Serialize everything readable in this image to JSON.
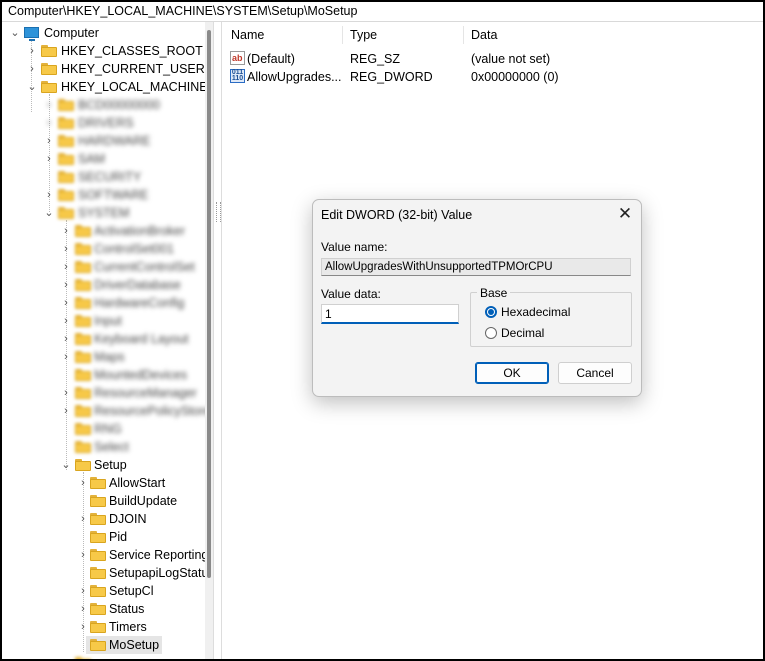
{
  "address_bar": {
    "path": "Computer\\HKEY_LOCAL_MACHINE\\SYSTEM\\Setup\\MoSetup"
  },
  "tree": {
    "root": "Computer",
    "hives": [
      {
        "label": "HKEY_CLASSES_ROOT",
        "chev": "›"
      },
      {
        "label": "HKEY_CURRENT_USER",
        "chev": "›"
      },
      {
        "label": "HKEY_LOCAL_MACHINE",
        "chev": "⌄"
      }
    ],
    "blurred_keys": [
      "BCD00000000",
      "DRIVERS",
      "HARDWARE",
      "SAM",
      "SECURITY",
      "SOFTWARE",
      "SYSTEM"
    ],
    "blurred_system_keys": [
      "ActivationBroker",
      "ControlSet001",
      "CurrentControlSet",
      "DriverDatabase",
      "HardwareConfig",
      "Input",
      "Keyboard Layout",
      "Maps",
      "MountedDevices",
      "ResourceManager",
      "ResourcePolicyStore",
      "RNG",
      "Select"
    ],
    "setup": "Setup",
    "setup_children": [
      "AllowStart",
      "BuildUpdate",
      "DJOIN",
      "Pid",
      "Service Reporting",
      "SetupapiLogStatus",
      "SetupCl",
      "Status",
      "Timers",
      "MoSetup"
    ],
    "selected": "MoSetup"
  },
  "list": {
    "columns": [
      "Name",
      "Type",
      "Data"
    ],
    "rows": [
      {
        "name": "(Default)",
        "type": "REG_SZ",
        "data": "(value not set)",
        "icon": "string-value-icon"
      },
      {
        "name": "AllowUpgrades...",
        "type": "REG_DWORD",
        "data": "0x00000000 (0)",
        "icon": "binary-value-icon"
      }
    ]
  },
  "dialog": {
    "title": "Edit DWORD (32-bit) Value",
    "close_glyph": "✕",
    "value_name_label": "Value name:",
    "value_name": "AllowUpgradesWithUnsupportedTPMOrCPU",
    "value_data_label": "Value data:",
    "value_data": "1",
    "base_label": "Base",
    "base_options": [
      "Hexadecimal",
      "Decimal"
    ],
    "base_selected": "Hexadecimal",
    "ok_label": "OK",
    "cancel_label": "Cancel"
  }
}
